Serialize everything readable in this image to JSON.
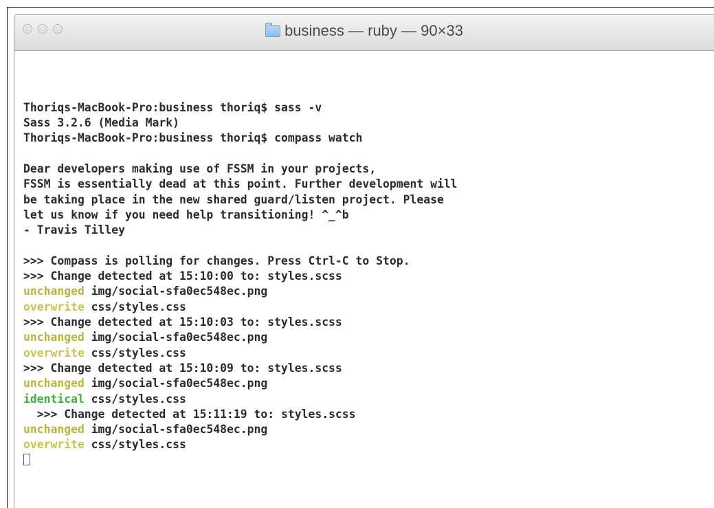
{
  "window": {
    "title": "business — ruby — 90×33",
    "title_icon": "folder-icon",
    "buttons": [
      "close-button",
      "minimize-button",
      "zoom-button"
    ]
  },
  "terminal": {
    "lines": [
      {
        "status": "",
        "text": "Thoriqs-MacBook-Pro:business thoriq$ sass -v"
      },
      {
        "status": "",
        "text": "Sass 3.2.6 (Media Mark)"
      },
      {
        "status": "",
        "text": "Thoriqs-MacBook-Pro:business thoriq$ compass watch"
      },
      {
        "status": "",
        "text": ""
      },
      {
        "status": "",
        "text": "Dear developers making use of FSSM in your projects,"
      },
      {
        "status": "",
        "text": "FSSM is essentially dead at this point. Further development will"
      },
      {
        "status": "",
        "text": "be taking place in the new shared guard/listen project. Please"
      },
      {
        "status": "",
        "text": "let us know if you need help transitioning! ^_^b"
      },
      {
        "status": "",
        "text": "- Travis Tilley"
      },
      {
        "status": "",
        "text": ""
      },
      {
        "status": "",
        "text": ">>> Compass is polling for changes. Press Ctrl-C to Stop."
      },
      {
        "status": "",
        "text": ">>> Change detected at 15:10:00 to: styles.scss"
      },
      {
        "status": "unchanged",
        "text": " img/social-sfa0ec548ec.png"
      },
      {
        "status": "overwrite",
        "text": " css/styles.css"
      },
      {
        "status": "",
        "text": ">>> Change detected at 15:10:03 to: styles.scss"
      },
      {
        "status": "unchanged",
        "text": " img/social-sfa0ec548ec.png"
      },
      {
        "status": "overwrite",
        "text": " css/styles.css"
      },
      {
        "status": "",
        "text": ">>> Change detected at 15:10:09 to: styles.scss"
      },
      {
        "status": "unchanged",
        "text": " img/social-sfa0ec548ec.png"
      },
      {
        "status": "identical",
        "text": " css/styles.css"
      },
      {
        "status": "",
        "text": "  >>> Change detected at 15:11:19 to: styles.scss"
      },
      {
        "status": "unchanged",
        "text": " img/social-sfa0ec548ec.png"
      },
      {
        "status": "overwrite",
        "text": " css/styles.css"
      }
    ],
    "colors": {
      "unchanged": "#b8b43c",
      "overwrite": "#c8c44e",
      "identical": "#3fae3f",
      "text": "#2b2b2b"
    }
  }
}
